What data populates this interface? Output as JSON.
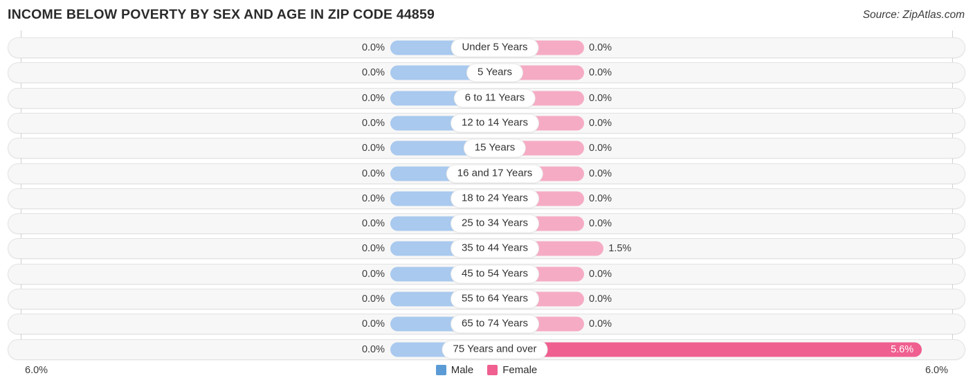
{
  "header": {
    "title": "INCOME BELOW POVERTY BY SEX AND AGE IN ZIP CODE 44859",
    "source": "Source: ZipAtlas.com"
  },
  "axis": {
    "left_label": "6.0%",
    "right_label": "6.0%"
  },
  "legend": {
    "items": [
      {
        "label": "Male",
        "color": "#5b9bd5"
      },
      {
        "label": "Female",
        "color": "#ef5f8f"
      }
    ]
  },
  "colors": {
    "male_bar": "#a9c9ee",
    "female_bar": "#f6abc4",
    "female_bar_highlight": "#ef5f8f",
    "track": "#f7f7f7",
    "track_border": "#e2e2e2"
  },
  "chart_data": {
    "type": "bar",
    "title": "INCOME BELOW POVERTY BY SEX AND AGE IN ZIP CODE 44859",
    "subtitle": "",
    "xlabel": "",
    "ylabel": "",
    "orientation": "horizontal-diverging",
    "grid": false,
    "legend_position": "bottom-center",
    "xlim": [
      6.0,
      6.0
    ],
    "axis_max_left": 6.0,
    "axis_max_right": 6.0,
    "unit": "%",
    "categories": [
      "Under 5 Years",
      "5 Years",
      "6 to 11 Years",
      "12 to 14 Years",
      "15 Years",
      "16 and 17 Years",
      "18 to 24 Years",
      "25 to 34 Years",
      "35 to 44 Years",
      "45 to 54 Years",
      "55 to 64 Years",
      "65 to 74 Years",
      "75 Years and over"
    ],
    "series": [
      {
        "name": "Male",
        "values": [
          0.0,
          0.0,
          0.0,
          0.0,
          0.0,
          0.0,
          0.0,
          0.0,
          0.0,
          0.0,
          0.0,
          0.0,
          0.0
        ],
        "labels": [
          "0.0%",
          "0.0%",
          "0.0%",
          "0.0%",
          "0.0%",
          "0.0%",
          "0.0%",
          "0.0%",
          "0.0%",
          "0.0%",
          "0.0%",
          "0.0%",
          "0.0%"
        ]
      },
      {
        "name": "Female",
        "values": [
          0.0,
          0.0,
          0.0,
          0.0,
          0.0,
          0.0,
          0.0,
          0.0,
          1.5,
          0.0,
          0.0,
          0.0,
          5.6
        ],
        "labels": [
          "0.0%",
          "0.0%",
          "0.0%",
          "0.0%",
          "0.0%",
          "0.0%",
          "0.0%",
          "0.0%",
          "1.5%",
          "0.0%",
          "0.0%",
          "0.0%",
          "5.6%"
        ]
      }
    ]
  }
}
